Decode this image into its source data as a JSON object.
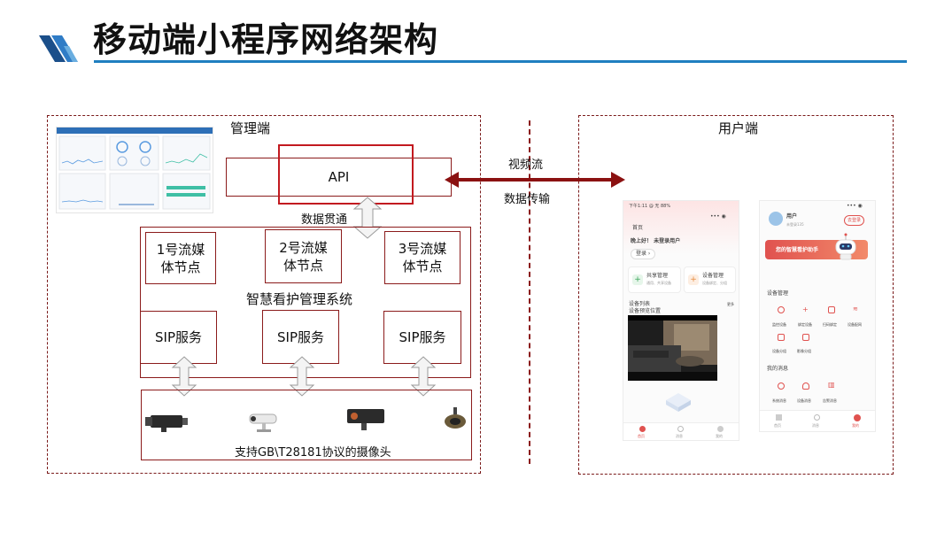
{
  "title": "移动端小程序网络架构",
  "admin": {
    "label": "管理端",
    "api": "API",
    "data_through": "数据贯通",
    "nodes": [
      "1号流媒\n体节点",
      "2号流媒\n体节点",
      "3号流媒\n体节点"
    ],
    "system": "智慧看护管理系统",
    "sip": [
      "SIP服务",
      "SIP服务",
      "SIP服务"
    ],
    "camera_caption": "支持GB\\T28181协议的摄像头"
  },
  "middle": {
    "video_stream": "视频流",
    "data_transfer": "数据传输"
  },
  "user": {
    "label": "用户端",
    "phone1": {
      "status": "下午1:11  @ 无  88%",
      "home": "首页",
      "greeting": "晚上好！ 未登录用户",
      "login_btn": "登录",
      "share_mgmt": "共享管理",
      "share_sub": "通用、共享设备",
      "device_mgmt": "设备管理",
      "device_sub": "设备绑定、分组",
      "device_list": "设备列表",
      "device_preview": "设备预览位置",
      "more": "更多",
      "tabs": [
        "首页",
        "消息",
        "我的"
      ]
    },
    "phone2": {
      "user_name": "用户",
      "user_sub": "未登录135",
      "login_btn": "去登录",
      "banner": "您的智慧看护助手",
      "section1": "设备管理",
      "items1": [
        "监控设备",
        "绑定设备",
        "扫码绑定",
        "设备配网",
        "设备分组",
        "影像分组"
      ],
      "section2": "我的消息",
      "items2": [
        "系统消息",
        "设备消息",
        "告警消息"
      ],
      "tabs": [
        "首页",
        "消息",
        "我的"
      ]
    }
  },
  "colors": {
    "dark_red": "#8b1b1b",
    "highlight_red": "#c2191f",
    "title_blue": "#1f7fc0",
    "accent_red": "#e0524f"
  }
}
